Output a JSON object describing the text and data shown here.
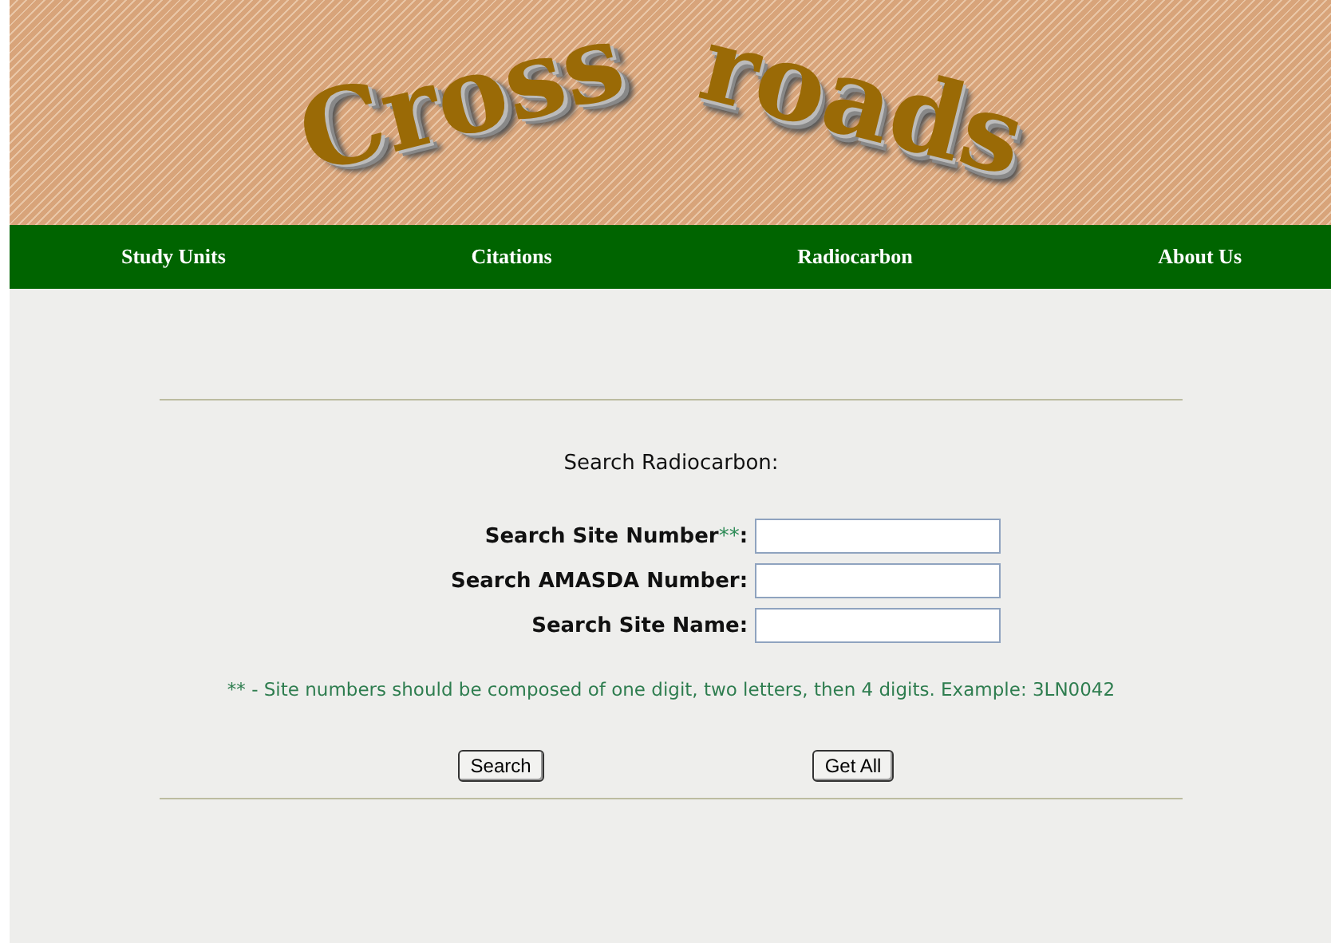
{
  "banner": {
    "logo_words": [
      "Cross",
      "roads"
    ]
  },
  "nav": [
    {
      "label": "Study Units"
    },
    {
      "label": "Citations"
    },
    {
      "label": "Radiocarbon"
    },
    {
      "label": "About Us"
    }
  ],
  "form": {
    "title": "Search Radiocarbon:",
    "fields": [
      {
        "label": "Search Site Number",
        "marker": "**",
        "suffix": ":"
      },
      {
        "label": "Search AMASDA Number:"
      },
      {
        "label": "Search Site Name:"
      }
    ],
    "note": "** - Site numbers should be composed of one digit, two letters, then 4 digits. Example: 3LN0042",
    "buttons": [
      "Search",
      "Get All"
    ]
  }
}
